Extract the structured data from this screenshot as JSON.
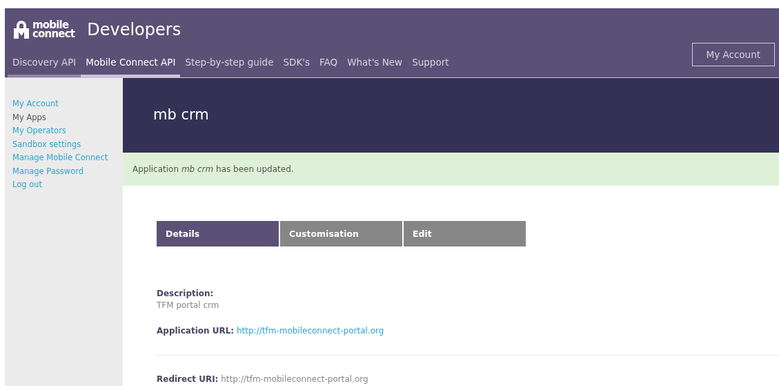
{
  "brand": {
    "logo_line_1": "mobile",
    "logo_line_2": "connect",
    "title": "Developers"
  },
  "nav": [
    {
      "label": "Discovery API",
      "selected": false,
      "highlighted": true
    },
    {
      "label": "Mobile Connect API",
      "selected": true,
      "highlighted": false
    },
    {
      "label": "Step-by-step guide",
      "selected": false,
      "highlighted": false
    },
    {
      "label": "SDK's",
      "selected": false,
      "highlighted": false
    },
    {
      "label": "FAQ",
      "selected": false,
      "highlighted": false
    },
    {
      "label": "What's New",
      "selected": false,
      "highlighted": false
    },
    {
      "label": "Support",
      "selected": false,
      "highlighted": false
    }
  ],
  "account_button": "My Account",
  "sidebar": {
    "items": [
      {
        "label": "My Account",
        "selected": false
      },
      {
        "label": "My Apps",
        "selected": true
      },
      {
        "label": "My Operators",
        "selected": false
      },
      {
        "label": "Sandbox settings",
        "selected": false
      },
      {
        "label": "Manage Mobile Connect",
        "selected": false
      },
      {
        "label": "Manage Password",
        "selected": false
      },
      {
        "label": "Log out",
        "selected": false
      }
    ]
  },
  "app_title": "mb crm",
  "alert": "Application *mb crm* has been updated.",
  "tabs": [
    {
      "label": "Details",
      "selected": true
    },
    {
      "label": "Customisation",
      "selected": false
    },
    {
      "label": "Edit",
      "selected": false
    }
  ],
  "details": [
    {
      "kind": "block",
      "label": "Description:",
      "value": "TFM portal crm"
    },
    {
      "kind": "link",
      "label": "Application URL:",
      "value": "http://tfm-mobileconnect-portal.org"
    },
    {
      "kind": "divider"
    },
    {
      "kind": "inline",
      "label": "Redirect URI:",
      "value": "http://tfm-mobileconnect-portal.org"
    }
  ]
}
